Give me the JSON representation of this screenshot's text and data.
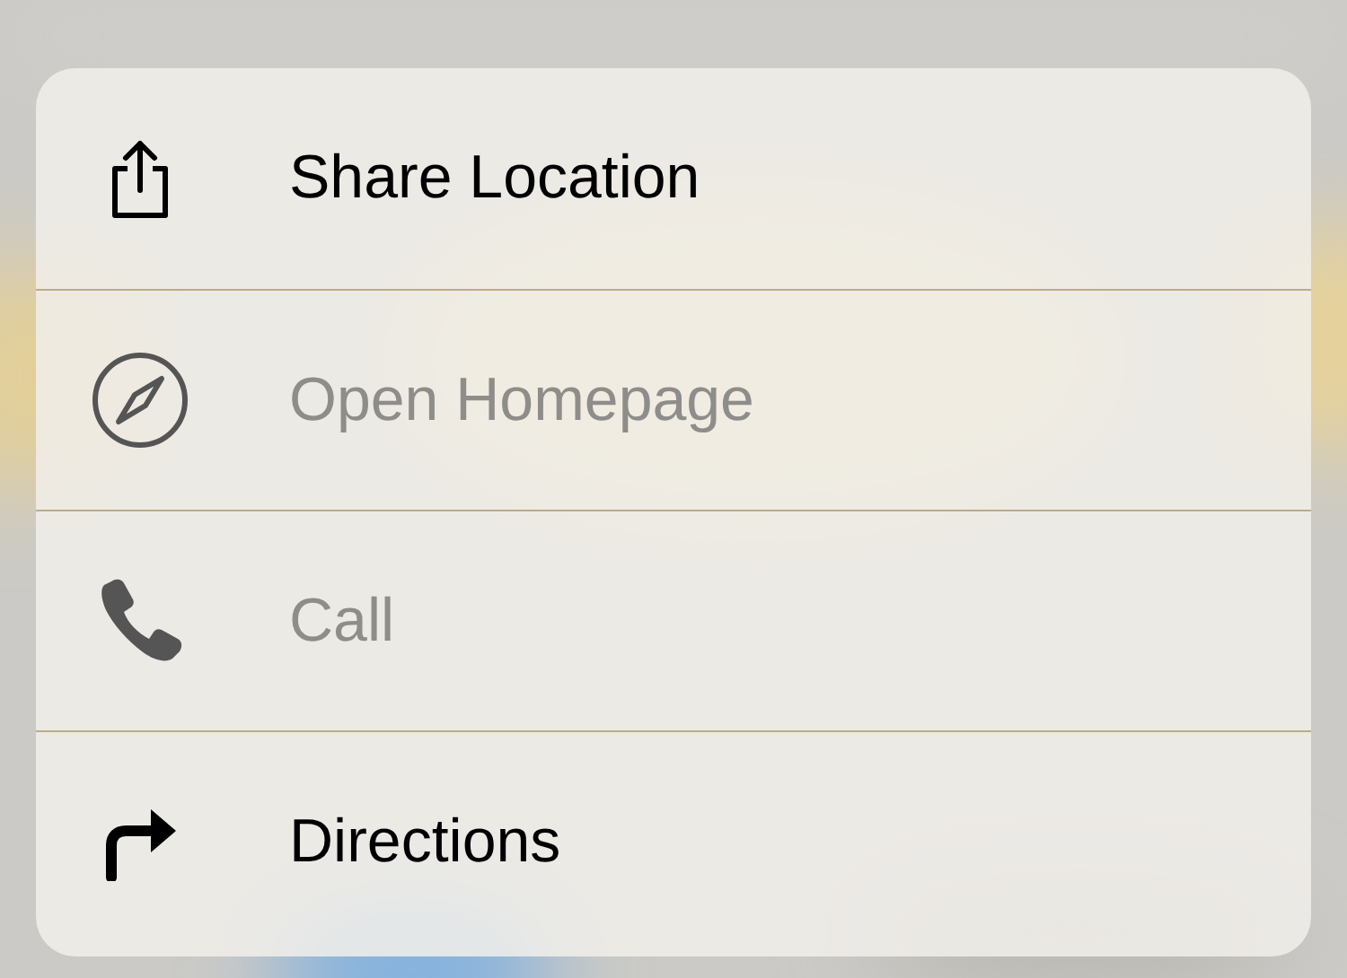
{
  "menu": {
    "items": [
      {
        "label": "Share Location",
        "disabled": false
      },
      {
        "label": "Open Homepage",
        "disabled": true
      },
      {
        "label": "Call",
        "disabled": true
      },
      {
        "label": "Directions",
        "disabled": false
      }
    ]
  }
}
